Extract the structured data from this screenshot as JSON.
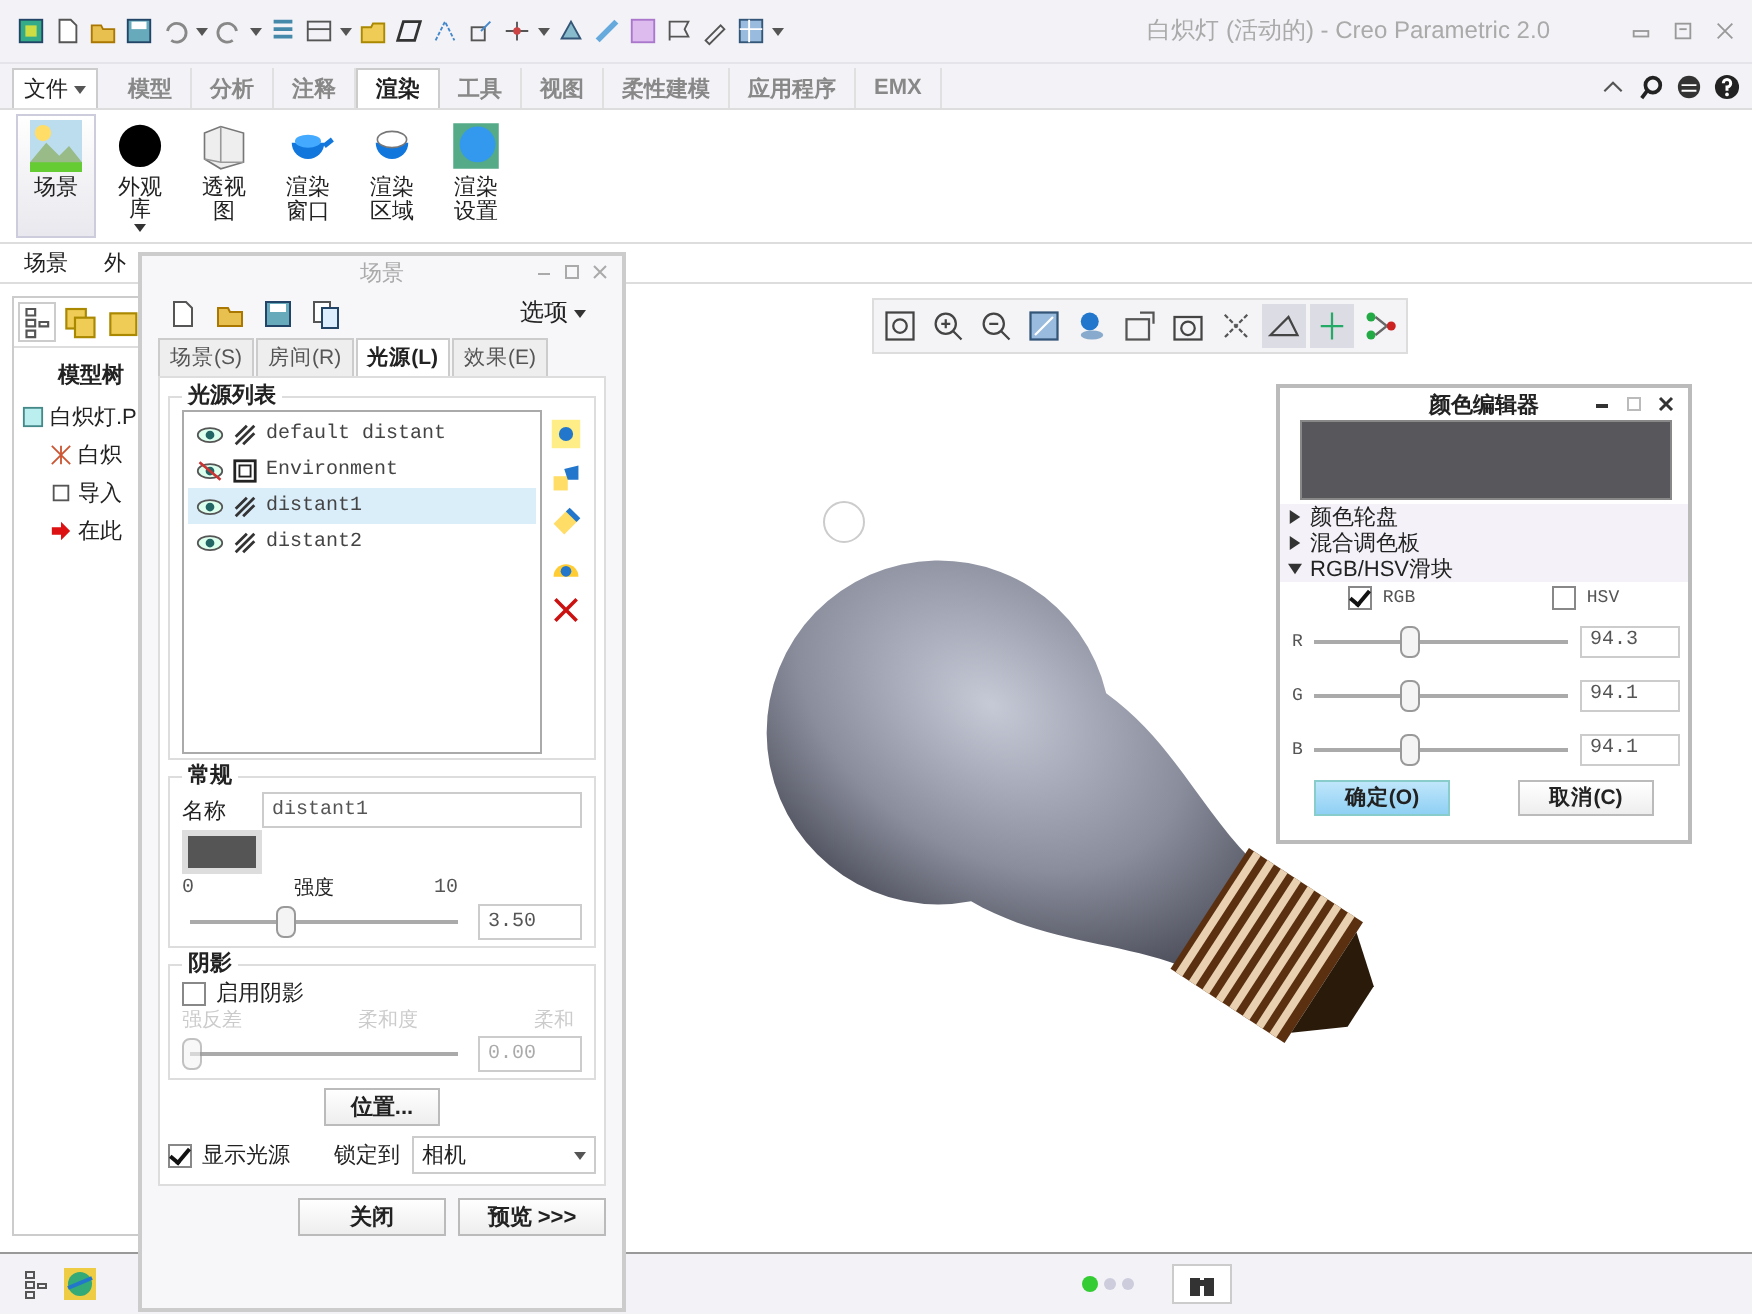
{
  "window": {
    "title": "白炽灯 (活动的) - Creo Parametric 2.0"
  },
  "ribbon": {
    "file_menu": "文件",
    "tabs": [
      {
        "label": "模型",
        "selected": false
      },
      {
        "label": "分析",
        "selected": false
      },
      {
        "label": "注释",
        "selected": false
      },
      {
        "label": "渲染",
        "selected": true
      },
      {
        "label": "工具",
        "selected": false
      },
      {
        "label": "视图",
        "selected": false
      },
      {
        "label": "柔性建模",
        "selected": false
      },
      {
        "label": "应用程序",
        "selected": false
      },
      {
        "label": "EMX",
        "selected": false
      }
    ],
    "buttons": [
      {
        "lines": [
          "场景"
        ],
        "selected": true,
        "dropdown": false
      },
      {
        "lines": [
          "外观",
          "库"
        ],
        "selected": false,
        "dropdown": true
      },
      {
        "lines": [
          "透视",
          "图"
        ],
        "selected": false,
        "dropdown": false
      },
      {
        "lines": [
          "渲染",
          "窗口"
        ],
        "selected": false,
        "dropdown": false
      },
      {
        "lines": [
          "渲染",
          "区域"
        ],
        "selected": false,
        "dropdown": false
      },
      {
        "lines": [
          "渲染",
          "设置"
        ],
        "selected": false,
        "dropdown": false
      }
    ],
    "group_labels": [
      "场景",
      "外"
    ]
  },
  "model_tree": {
    "tab": "模型树",
    "items": [
      {
        "label": "白炽灯.P",
        "children": [
          {
            "label": "白炽"
          },
          {
            "label": "导入"
          },
          {
            "label": "在此"
          }
        ]
      }
    ]
  },
  "scene_dialog": {
    "title": "场景",
    "options": "选项",
    "tabs": [
      {
        "label": "场景(S)",
        "selected": false
      },
      {
        "label": "房间(R)",
        "selected": false
      },
      {
        "label": "光源(L)",
        "selected": true
      },
      {
        "label": "效果(E)",
        "selected": false
      }
    ],
    "light_list": {
      "title": "光源列表",
      "items": [
        {
          "name": "default distant",
          "kind": "distant",
          "visible": true,
          "selected": false
        },
        {
          "name": "Environment",
          "kind": "environment",
          "visible": false,
          "selected": false
        },
        {
          "name": "distant1",
          "kind": "distant",
          "visible": true,
          "selected": true
        },
        {
          "name": "distant2",
          "kind": "distant",
          "visible": true,
          "selected": false
        }
      ]
    },
    "general": {
      "title": "常规",
      "name_label": "名称",
      "name_value": "distant1",
      "intensity": {
        "label": "强度",
        "min": "0",
        "max": "10",
        "level": 0.35,
        "value": "3.50"
      }
    },
    "shadow": {
      "title": "阴影",
      "enable_label": "启用阴影",
      "checked": false,
      "disabled": true,
      "labels": [
        "强反差",
        "柔和度",
        "柔和"
      ],
      "level": 0,
      "value": "0.00"
    },
    "position_button": "位置...",
    "show_lights": {
      "label": "显示光源",
      "checked": true
    },
    "lock_label": "锁定到",
    "lock_value": "相机",
    "buttons": [
      "关闭",
      "预览 >>>"
    ]
  },
  "color_editor": {
    "title": "颜色编辑器",
    "sections": [
      {
        "label": "颜色轮盘",
        "expanded": false
      },
      {
        "label": "混合调色板",
        "expanded": false
      },
      {
        "label": "RGB/HSV滑块",
        "expanded": true
      }
    ],
    "modes": [
      {
        "label": "RGB",
        "checked": true
      },
      {
        "label": "HSV",
        "checked": false
      }
    ],
    "sliders": [
      {
        "label": "R",
        "level": 0.37,
        "value": "94.3"
      },
      {
        "label": "G",
        "level": 0.37,
        "value": "94.1"
      },
      {
        "label": "B",
        "level": 0.37,
        "value": "94.1"
      }
    ],
    "buttons": [
      {
        "label": "确定(O)",
        "kind": "primary"
      },
      {
        "label": "取消(C)",
        "kind": "normal"
      }
    ]
  }
}
